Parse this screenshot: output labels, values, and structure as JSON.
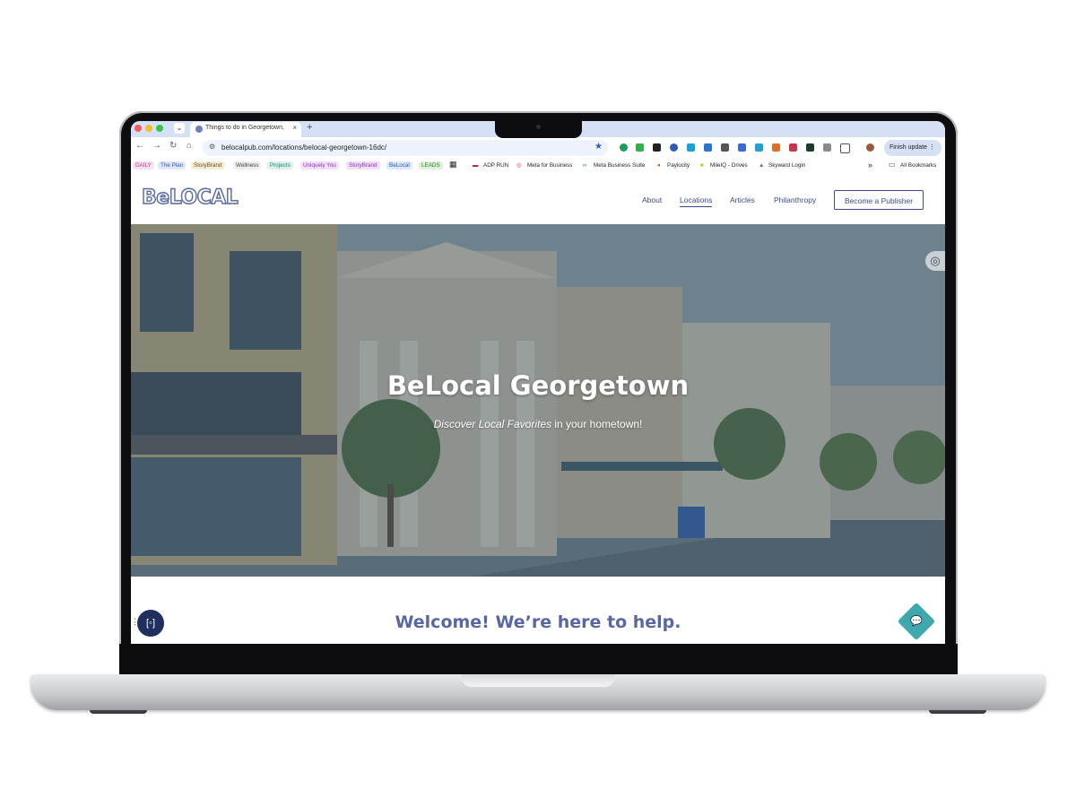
{
  "browser": {
    "tab_title": "Things to do in Georgetown,",
    "tab_close": "×",
    "new_tab": "+",
    "url": "belocalpub.com/locations/belocal-georgetown-16dc/",
    "finish_update": "Finish update",
    "bookmarks_tags": [
      {
        "label": "DAILY",
        "bg": "#f8e2ef",
        "fg": "#b03a82"
      },
      {
        "label": "The Plan",
        "bg": "#dde8fb",
        "fg": "#2c58b8"
      },
      {
        "label": "StoryBrand",
        "bg": "#f6ecd6",
        "fg": "#6a4a10"
      },
      {
        "label": "Wellness",
        "bg": "#eeeeee",
        "fg": "#444444"
      },
      {
        "label": "Projects",
        "bg": "#dcf2ee",
        "fg": "#1d7c6b"
      },
      {
        "label": "Uniquely You",
        "bg": "#f0e0fa",
        "fg": "#8d2fc1"
      },
      {
        "label": "StoryBrand",
        "bg": "#f0e0fa",
        "fg": "#8d2fc1"
      },
      {
        "label": "BeLocal",
        "bg": "#dde8fb",
        "fg": "#2c58b8"
      },
      {
        "label": "LEADS",
        "bg": "#dff3dc",
        "fg": "#267a20"
      }
    ],
    "bookmarks_links": [
      "ADP RUN",
      "Meta for Business",
      "Meta Business Suite",
      "Paylocity",
      "MileIQ - Drives",
      "Skyward Login"
    ],
    "bookmarks_overflow": "»",
    "all_bookmarks": "All Bookmarks"
  },
  "site": {
    "logo": "BeLOCAL",
    "nav": [
      "About",
      "Locations",
      "Articles",
      "Philanthropy"
    ],
    "cta": "Become a Publisher"
  },
  "hero": {
    "title": "BeLocal Georgetown",
    "subtitle_em": "Discover Local Favorites",
    "subtitle_rest": " in your hometown!"
  },
  "welcome": "Welcome! We’re here to help."
}
